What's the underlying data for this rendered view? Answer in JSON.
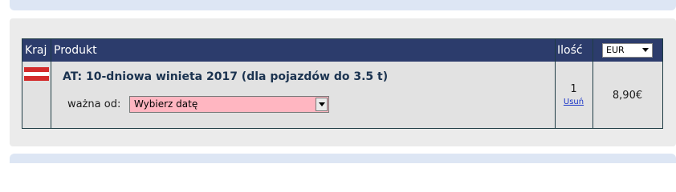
{
  "table": {
    "headers": {
      "country": "Kraj",
      "product": "Produkt",
      "quantity": "Ilość"
    },
    "currency": {
      "selected": "EUR",
      "icon": "chevron-down-icon"
    }
  },
  "item": {
    "country_flag": {
      "icon": "austria-flag-icon",
      "colors": [
        "#d32b2b",
        "#ffffff",
        "#d32b2b"
      ]
    },
    "title": "AT: 10-dniowa winieta 2017 (dla pojazdów do 3.5 t)",
    "valid_from_label": "ważna od:",
    "date_select": {
      "selected": "Wybierz datę",
      "background": "#ffb6c1"
    },
    "quantity": "1",
    "remove_label": "Usuń",
    "price": "8,90€"
  },
  "colors": {
    "header_bg": "#2c3c6c",
    "link": "#1a35c8",
    "title_text": "#1b3350"
  }
}
